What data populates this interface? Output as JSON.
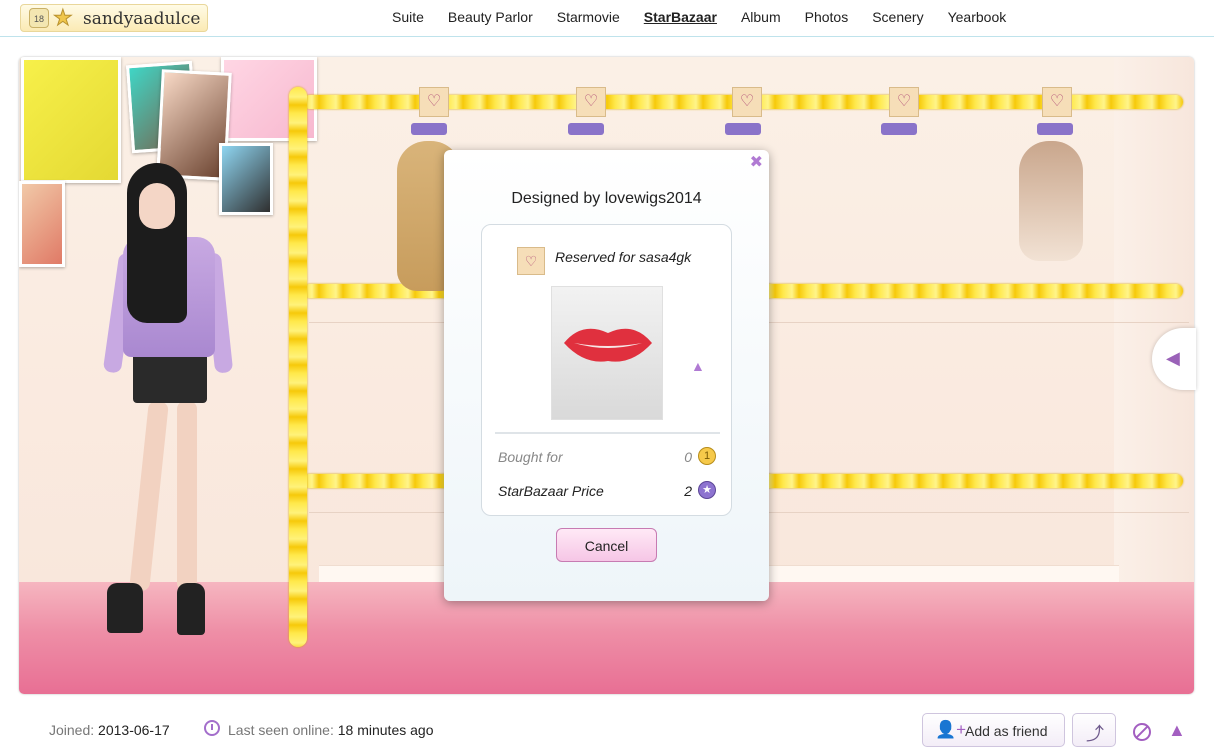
{
  "header": {
    "username": "sandyaadulce",
    "level": "18",
    "nav": [
      {
        "label": "Suite",
        "active": false
      },
      {
        "label": "Beauty Parlor",
        "active": false
      },
      {
        "label": "Starmovie",
        "active": false
      },
      {
        "label": "StarBazaar",
        "active": true
      },
      {
        "label": "Album",
        "active": false
      },
      {
        "label": "Photos",
        "active": false
      },
      {
        "label": "Scenery",
        "active": false
      },
      {
        "label": "Yearbook",
        "active": false
      }
    ]
  },
  "dialog": {
    "title": "Designed by lovewigs2014",
    "reserved_text": "Reserved for sasa4gk",
    "bought_for_label": "Bought for",
    "bought_for_value": "0",
    "price_label": "StarBazaar Price",
    "price_value": "2",
    "cancel_label": "Cancel",
    "close_icon": "close-icon",
    "warn_icon": "warning-icon"
  },
  "footer": {
    "joined_label": "Joined:",
    "joined_value": "2013-06-17",
    "seen_label": "Last seen online:",
    "seen_value": "18 minutes ago",
    "add_friend_label": "Add as friend"
  },
  "colors": {
    "accent": "#a35fc1",
    "pole": "#ffe84a",
    "floor": "#ee8ea6"
  }
}
